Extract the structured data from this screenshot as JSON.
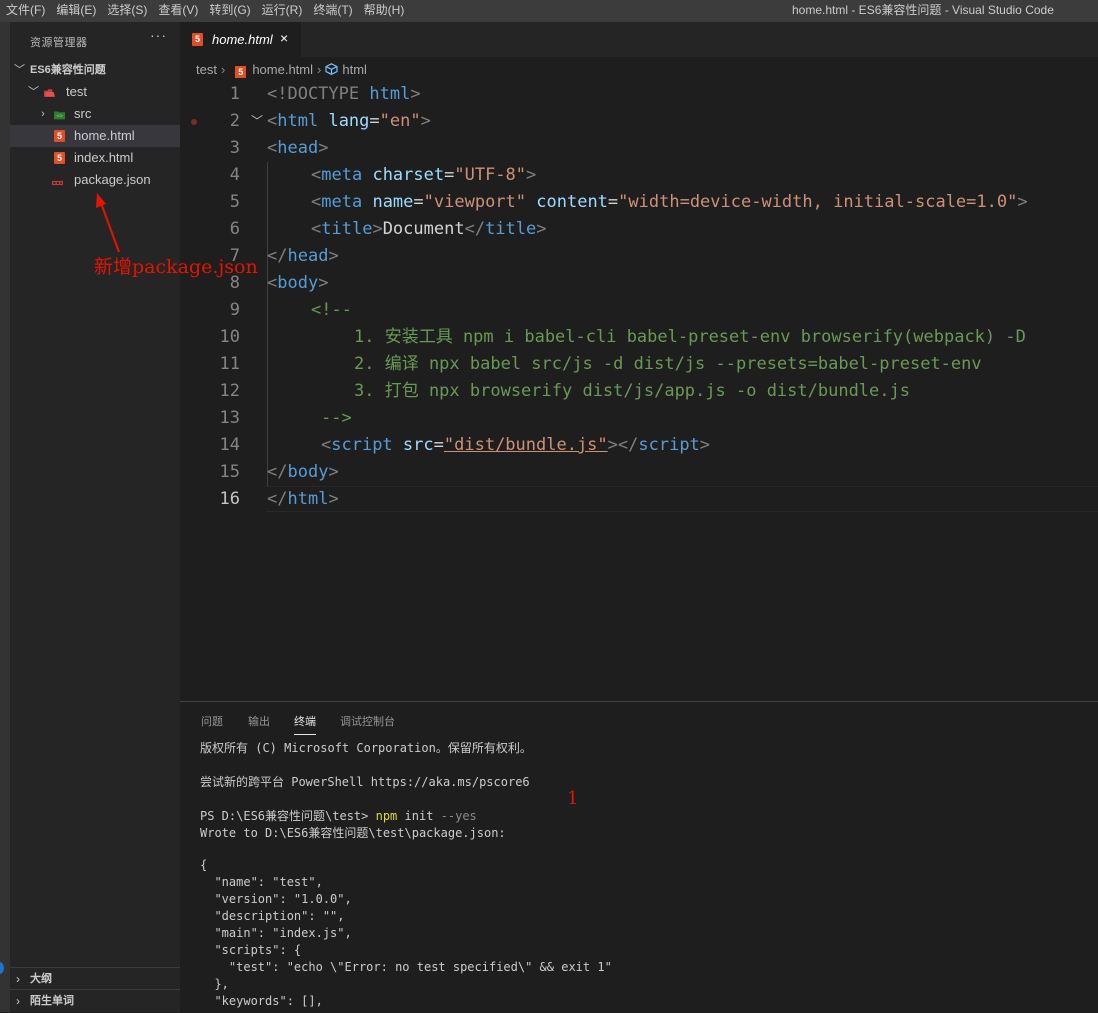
{
  "menu": [
    "文件(F)",
    "编辑(E)",
    "选择(S)",
    "查看(V)",
    "转到(G)",
    "运行(R)",
    "终端(T)",
    "帮助(H)"
  ],
  "window_title": "home.html - ES6兼容性问题 - Visual Studio Code",
  "sidebar": {
    "header": "资源管理器",
    "more": "···",
    "root_folder": "ES6兼容性问题",
    "items": [
      {
        "label": "test",
        "kind": "folder"
      },
      {
        "label": "src",
        "kind": "folder"
      },
      {
        "label": "home.html",
        "kind": "html"
      },
      {
        "label": "index.html",
        "kind": "html"
      },
      {
        "label": "package.json",
        "kind": "json"
      }
    ],
    "sections": [
      "大纲",
      "陌生单词"
    ]
  },
  "annotations": {
    "left_note": "新增package.json",
    "step_marker": "1",
    "color": "#e51400"
  },
  "editor": {
    "tab_label": "home.html",
    "tab_close": "×",
    "breadcrumb": [
      "test",
      "home.html",
      "html"
    ],
    "line_numbers": [
      "1",
      "2",
      "3",
      "4",
      "5",
      "6",
      "7",
      "8",
      "9",
      "10",
      "11",
      "12",
      "13",
      "14",
      "15",
      "16"
    ],
    "code": {
      "l1": [
        "<!DOCTYPE ",
        "html",
        ">"
      ],
      "l2": [
        "<",
        "html",
        " ",
        "lang",
        "=",
        "\"en\"",
        ">"
      ],
      "l3": [
        "<",
        "head",
        ">"
      ],
      "l4": [
        "<",
        "meta",
        " ",
        "charset",
        "=",
        "\"UTF-8\"",
        ">"
      ],
      "l5": [
        "<",
        "meta",
        " ",
        "name",
        "=",
        "\"viewport\"",
        " ",
        "content",
        "=",
        "\"width=device-width, initial-scale=1.0\"",
        ">"
      ],
      "l6": [
        "<",
        "title",
        ">",
        "Document",
        "</",
        "title",
        ">"
      ],
      "l7": [
        "</",
        "head",
        ">"
      ],
      "l8": [
        "<",
        "body",
        ">"
      ],
      "l9": "<!--",
      "l10": "1. 安装工具 npm i babel-cli babel-preset-env browserify(webpack) -D",
      "l11": "2. 编译 npx babel src/js -d dist/js --presets=babel-preset-env",
      "l12": "3. 打包 npx browserify dist/js/app.js -o dist/bundle.js",
      "l13": "-->",
      "l14": [
        "<",
        "script",
        " ",
        "src",
        "=",
        "\"dist/bundle.js\"",
        "></",
        "script",
        ">"
      ],
      "l15": [
        "</",
        "body",
        ">"
      ],
      "l16": [
        "</",
        "html",
        ">"
      ]
    },
    "active_line": "16"
  },
  "panel": {
    "tabs": [
      "问题",
      "输出",
      "终端",
      "调试控制台"
    ],
    "active_tab": "终端",
    "terminal": {
      "copyright": "版权所有 (C) Microsoft Corporation。保留所有权利。",
      "try_new": "尝试新的跨平台 PowerShell https://aka.ms/pscore6",
      "prompt": "PS D:\\ES6兼容性问题\\test> ",
      "command": "npm",
      "command_arg": " init ",
      "command_flag": "--yes",
      "wrote": "Wrote to D:\\ES6兼容性问题\\test\\package.json:",
      "json_lines": [
        "{",
        "  \"name\": \"test\",",
        "  \"version\": \"1.0.0\",",
        "  \"description\": \"\",",
        "  \"main\": \"index.js\",",
        "  \"scripts\": {",
        "    \"test\": \"echo \\\"Error: no test specified\\\" && exit 1\"",
        "  },",
        "  \"keywords\": [],"
      ]
    }
  }
}
